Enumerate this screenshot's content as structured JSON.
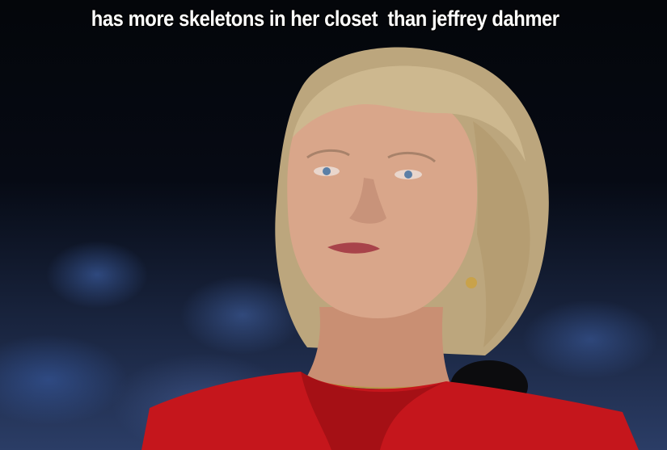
{
  "caption": "has more skeletons in her closet  than jeffrey dahmer",
  "colors": {
    "background": "#05070c",
    "caption_text": "#ffffff",
    "jacket": "#c5161c",
    "hair": "#c9b48c",
    "skin": "#d8a487"
  }
}
